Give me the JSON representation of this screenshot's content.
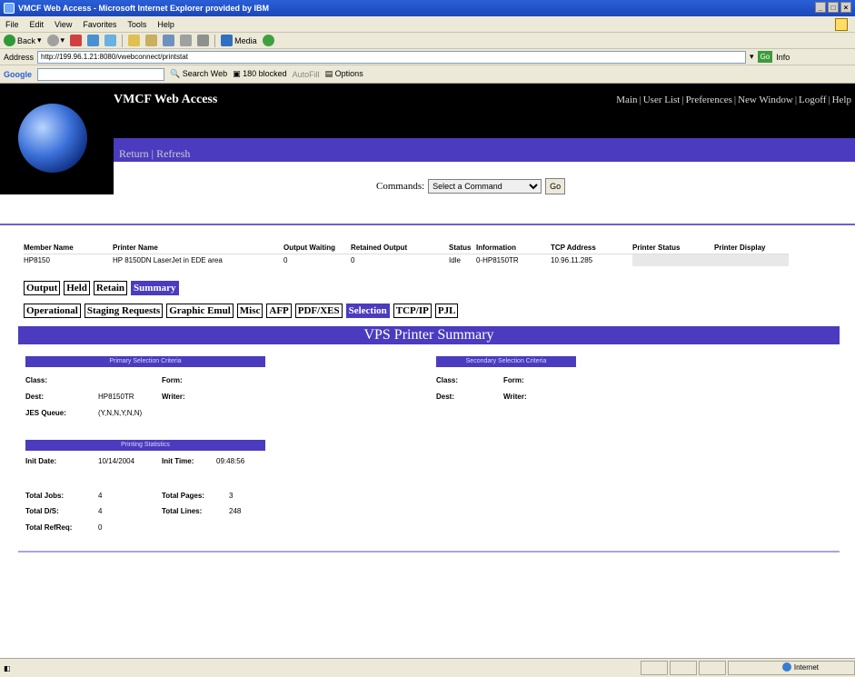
{
  "window": {
    "title": "VMCF Web Access - Microsoft Internet Explorer provided by IBM",
    "controls": [
      "_",
      "□",
      "×"
    ]
  },
  "menu": [
    "File",
    "Edit",
    "View",
    "Favorites",
    "Tools",
    "Help"
  ],
  "toolbar": {
    "back": "Back",
    "media": "Media"
  },
  "address": {
    "label": "Address",
    "url": "http://199.96.1.21:8080/vwebconnect/printstat",
    "go": "Go",
    "links": "Info"
  },
  "google": {
    "logo": "Google",
    "search_web": "Search Web",
    "blocked": "180 blocked",
    "autofill": "AutoFill",
    "options": "Options"
  },
  "header": {
    "site_title": "VMCF Web Access",
    "top_links": [
      "Main",
      "User List",
      "Preferences",
      "New Window",
      "Logoff",
      "Help"
    ],
    "sub_links": [
      "Return",
      "Refresh"
    ]
  },
  "command": {
    "label": "Commands:",
    "selected": "Select a Command",
    "go": "Go"
  },
  "info_table": {
    "headers": [
      "Member Name",
      "Printer Name",
      "Output Waiting",
      "Retained Output",
      "Status",
      "Information",
      "TCP Address",
      "Printer Status",
      "Printer Display"
    ],
    "row": [
      "HP8150",
      "HP 8150DN LaserJet in EDE area",
      "0",
      "0",
      "Idle",
      "0-HP8150TR",
      "10.96.11.285",
      "",
      ""
    ]
  },
  "tabs_row1": [
    {
      "label": "Output",
      "active": false
    },
    {
      "label": "Held",
      "active": false
    },
    {
      "label": "Retain",
      "active": false
    },
    {
      "label": "Summary",
      "active": true
    }
  ],
  "tabs_row2": [
    {
      "label": "Operational",
      "active": false
    },
    {
      "label": "Staging Requests",
      "active": false
    },
    {
      "label": "Graphic Emul",
      "active": false
    },
    {
      "label": "Misc",
      "active": false
    },
    {
      "label": "AFP",
      "active": false
    },
    {
      "label": "PDF/XES",
      "active": false
    },
    {
      "label": "Selection",
      "active": true
    },
    {
      "label": "TCP/IP",
      "active": false
    },
    {
      "label": "PJL",
      "active": false
    }
  ],
  "banner": "VPS Printer Summary",
  "primary": {
    "title": "Primary Selection Criteria",
    "class_label": "Class:",
    "class_value": "",
    "form_label": "Form:",
    "form_value": "",
    "dest_label": "Dest:",
    "dest_value": "HP8150TR",
    "writer_label": "Writer:",
    "writer_value": "",
    "jes_label": "JES Queue:",
    "jes_value": "(Y,N,N,Y,N,N)"
  },
  "secondary": {
    "title": "Secondary Selection Criteria",
    "class_label": "Class:",
    "form_label": "Form:",
    "dest_label": "Dest:",
    "writer_label": "Writer:"
  },
  "stats": {
    "title": "Printing Statistics",
    "init_date_label": "Init Date:",
    "init_date": "10/14/2004",
    "init_time_label": "Init Time:",
    "init_time": "09:48:56",
    "total_jobs_label": "Total Jobs:",
    "total_jobs": "4",
    "total_pages_label": "Total Pages:",
    "total_pages": "3",
    "total_dss_label": "Total D/S:",
    "total_dss": "4",
    "total_lines_label": "Total Lines:",
    "total_lines": "248",
    "total_refreq_label": "Total RefReq:",
    "total_refreq": "0"
  },
  "status": {
    "left": "",
    "zone": "Internet"
  }
}
